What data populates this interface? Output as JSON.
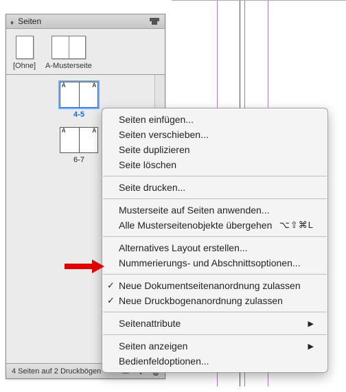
{
  "panel": {
    "title": "Seiten",
    "masters": [
      {
        "label": "[Ohne]"
      },
      {
        "label": "A-Musterseite"
      }
    ],
    "spreads": [
      {
        "label": "4-5",
        "master_left": "A",
        "master_right": "A",
        "selected": true
      },
      {
        "label": "6-7",
        "master_left": "A",
        "master_right": "A",
        "selected": false
      }
    ],
    "footer": "4 Seiten auf 2 Druckbögen"
  },
  "footer_icons": {
    "layout": "layout-icon",
    "new": "new-page-icon",
    "trash": "trash-icon"
  },
  "context_menu": {
    "items": [
      {
        "label": "Seiten einfügen...",
        "type": "item"
      },
      {
        "label": "Seiten verschieben...",
        "type": "item"
      },
      {
        "label": "Seite duplizieren",
        "type": "item"
      },
      {
        "label": "Seite löschen",
        "type": "item"
      },
      {
        "type": "sep"
      },
      {
        "label": "Seite drucken...",
        "type": "item"
      },
      {
        "type": "sep"
      },
      {
        "label": "Musterseite auf Seiten anwenden...",
        "type": "item"
      },
      {
        "label": "Alle Musterseitenobjekte übergehen",
        "type": "item",
        "shortcut": "⌥⇧⌘L"
      },
      {
        "type": "sep"
      },
      {
        "label": "Alternatives Layout erstellen...",
        "type": "item"
      },
      {
        "label": "Nummerierungs- und Abschnittsoptionen...",
        "type": "item"
      },
      {
        "type": "sep"
      },
      {
        "label": "Neue Dokumentseitenanordnung zulassen",
        "type": "check"
      },
      {
        "label": "Neue Druckbogenanordnung zulassen",
        "type": "check"
      },
      {
        "type": "sep"
      },
      {
        "label": "Seitenattribute",
        "type": "sub"
      },
      {
        "type": "sep"
      },
      {
        "label": "Seiten anzeigen",
        "type": "sub"
      },
      {
        "label": "Bedienfeldoptionen...",
        "type": "item"
      }
    ]
  }
}
